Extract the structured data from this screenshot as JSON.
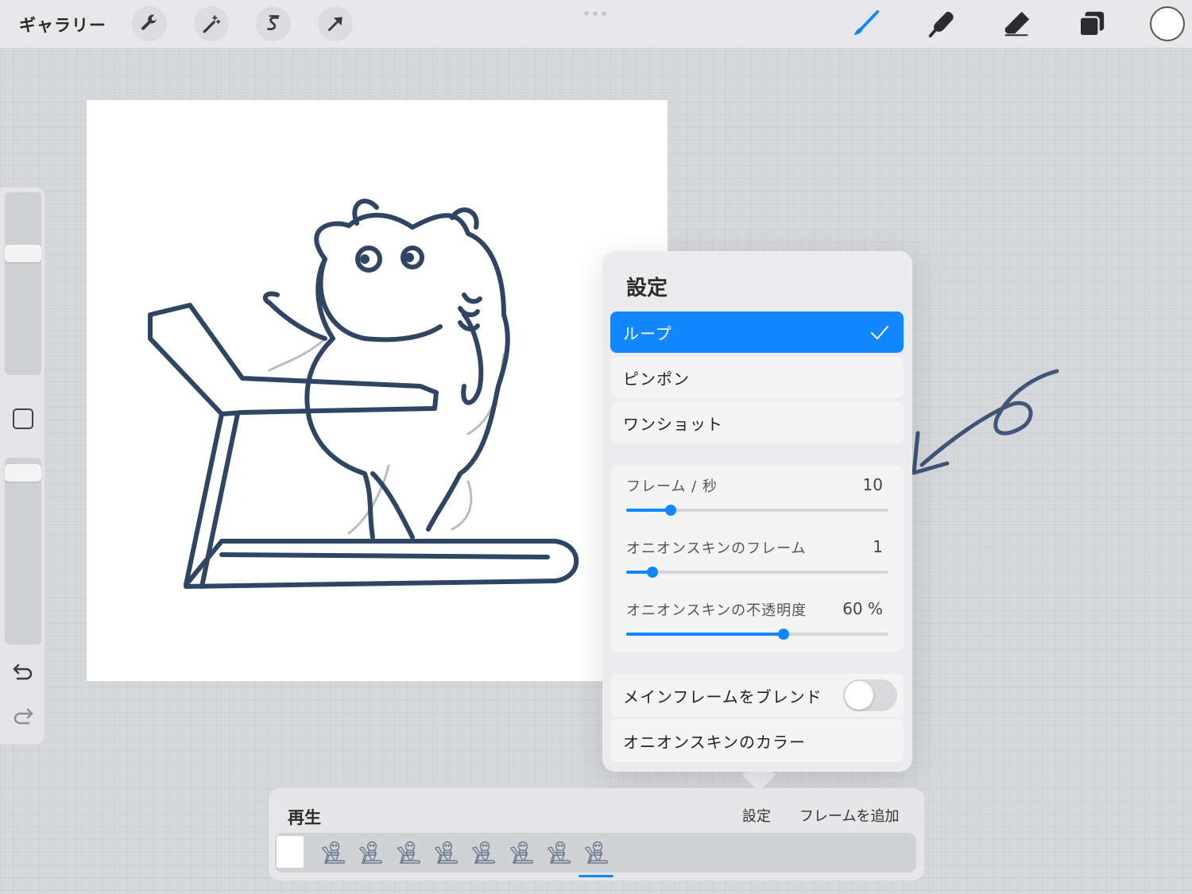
{
  "topbar": {
    "gallery_label": "ギャラリー",
    "left_tools": [
      "wrench-icon",
      "magic-wand-icon",
      "selection-icon",
      "transform-arrow-icon"
    ],
    "right_tools": [
      "brush-icon",
      "smudge-icon",
      "eraser-icon",
      "layers-icon"
    ],
    "active_tool": "brush-icon",
    "current_color": "#ffffff"
  },
  "sidebar": {
    "controls": [
      "brush-size-slider",
      "modify-button",
      "opacity-slider",
      "undo-icon",
      "redo-icon"
    ]
  },
  "settings_popover": {
    "title": "設定",
    "playback_options": [
      {
        "label": "ループ",
        "selected": true
      },
      {
        "label": "ピンポン",
        "selected": false
      },
      {
        "label": "ワンショット",
        "selected": false
      }
    ],
    "sliders": [
      {
        "label": "フレーム / 秒",
        "value_text": "10",
        "level": 0.17
      },
      {
        "label": "オニオンスキンのフレーム",
        "value_text": "1",
        "level": 0.1
      },
      {
        "label": "オニオンスキンの不透明度",
        "value_text": "60 %",
        "level": 0.6
      }
    ],
    "blend_main_frame": {
      "label": "メインフレームをブレンド",
      "on": false
    },
    "onion_skin_color_label": "オニオンスキンのカラー"
  },
  "timeline": {
    "play_label": "再生",
    "settings_label": "設定",
    "add_frame_label": "フレームを追加",
    "frame_count": 9
  },
  "colors": {
    "accent": "#1387ff",
    "ink": "#2f4563"
  }
}
